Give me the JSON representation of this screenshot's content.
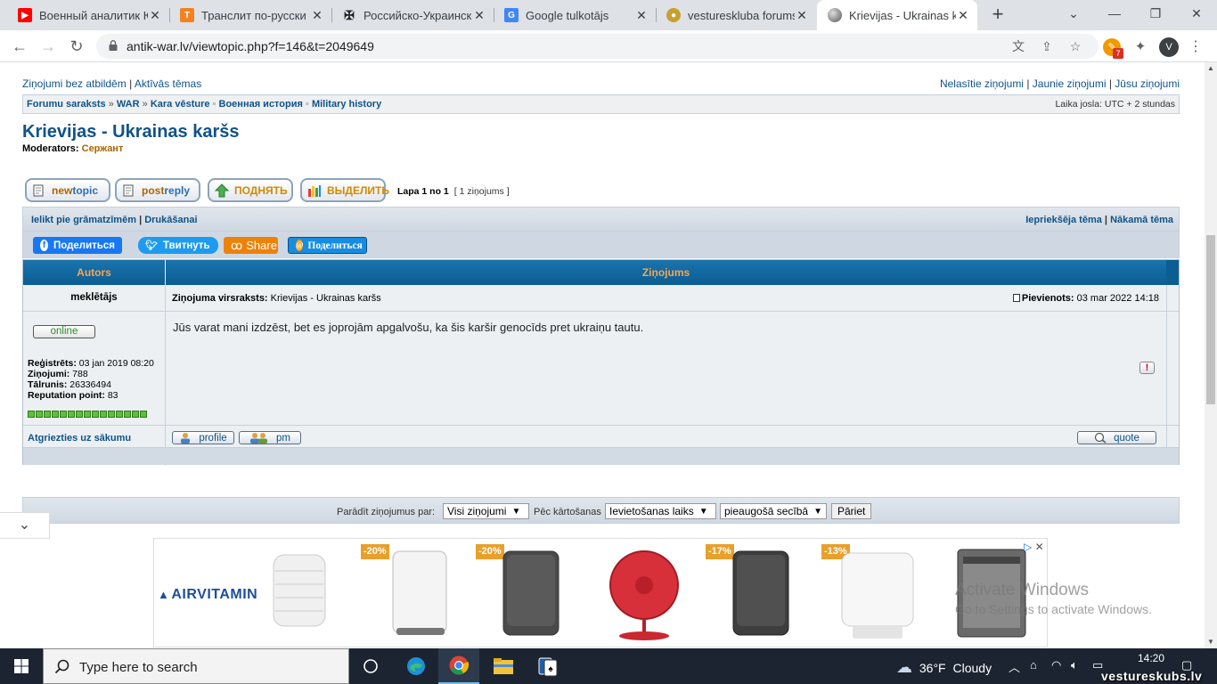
{
  "browser": {
    "tabs": [
      {
        "title": "Военный аналитик Ю",
        "icon": "youtube-icon",
        "color": "#ff0000"
      },
      {
        "title": "Транслит по-русски",
        "icon": "translit-icon",
        "color": "#f58220"
      },
      {
        "title": "Российско-Украинск",
        "icon": "wiki-cross-icon",
        "color": "#333333"
      },
      {
        "title": "Google tulkotājs",
        "icon": "google-translate-icon",
        "color": "#4285f4"
      },
      {
        "title": "vestureskluba forums",
        "icon": "forum-icon",
        "color": "#c8a030"
      },
      {
        "title": "Krievijas - Ukrainas ka",
        "icon": "antikwar-icon",
        "color": "#777777"
      }
    ],
    "url": "antik-war.lv/viewtopic.php?f=146&t=2049649",
    "ext_badge": "7",
    "profile_initial": "V"
  },
  "page": {
    "top_left_links": [
      "Ziņojumi bez atbildēm",
      "Aktīvās tēmas"
    ],
    "top_right_links": [
      "Nelasītie ziņojumi",
      "Jaunie ziņojumi",
      "Jūsu ziņojumi"
    ],
    "breadcrumbs": [
      "Forumu saraksts",
      "WAR",
      "Kara vēsture",
      "Военная история",
      "Military history"
    ],
    "timezone": "Laika josla: UTC + 2 stundas",
    "forum_title": "Krievijas - Ukrainas karšs",
    "moderators_label": "Moderators:",
    "moderator": "Сержант",
    "buttons": {
      "new_a": "new",
      "new_b": "topic",
      "post_a": "post",
      "post_b": "reply",
      "bump": "ПОДНЯТЬ",
      "highlight": "ВЫДЕЛИТЬ"
    },
    "pagination": "Lapa 1 no 1",
    "post_count": "[ 1 ziņojums ]",
    "action_left": [
      "Ielikt pie grāmatzīmēm",
      "Drukāšanai"
    ],
    "action_right": [
      "Iepriekšēja tēma",
      "Nākamā tēma"
    ],
    "share": {
      "facebook": "Поделиться",
      "twitter": "Твитнуть",
      "odnoklassniki": "Share",
      "mailru": "Поделиться"
    },
    "table": {
      "col_author": "Autors",
      "col_message": "Ziņojums"
    },
    "post": {
      "author": "meklētājs",
      "subject_label": "Ziņojuma virsraksts:",
      "subject": "Krievijas - Ukrainas karšs",
      "posted_label": "Pievienots:",
      "posted": "03 mar 2022 14:18",
      "status": "online",
      "registered_label": "Reģistrēts:",
      "registered": "03 jan 2019 08:20",
      "posts_label": "Ziņojumi:",
      "posts": "788",
      "phone_label": "Tālrunis:",
      "phone": "26336494",
      "rep_label": "Reputation point:",
      "rep": "83",
      "body": "Jūs varat mani izdzēst, bet es joprojām apgalvošu, ka šis karšir genocīds pret ukraiņu tautu.",
      "back_to_top": "Atgriezties uz sākumu",
      "profile_btn": "profile",
      "pm_btn": "pm",
      "quote_btn": "quote"
    },
    "bottom": {
      "show_label": "Parādīt ziņojumus par:",
      "show_value": "Visi ziņojumi",
      "sort_label": "Pēc kārtošanas",
      "sort_value": "Ievietošanas laiks",
      "order_value": "pieaugošā secībā",
      "go": "Pāriet"
    }
  },
  "ad": {
    "brand": "AIRVITAMIN",
    "discounts": [
      "-20%",
      "-20%",
      "-17%",
      "-13%"
    ]
  },
  "activation": {
    "line1": "Activate Windows",
    "line2": "Go to Settings to activate Windows."
  },
  "taskbar": {
    "search_placeholder": "Type here to search",
    "temperature": "36°F",
    "weather": "Cloudy",
    "time": "14:20"
  },
  "watermark": "vestureskubs.lv"
}
